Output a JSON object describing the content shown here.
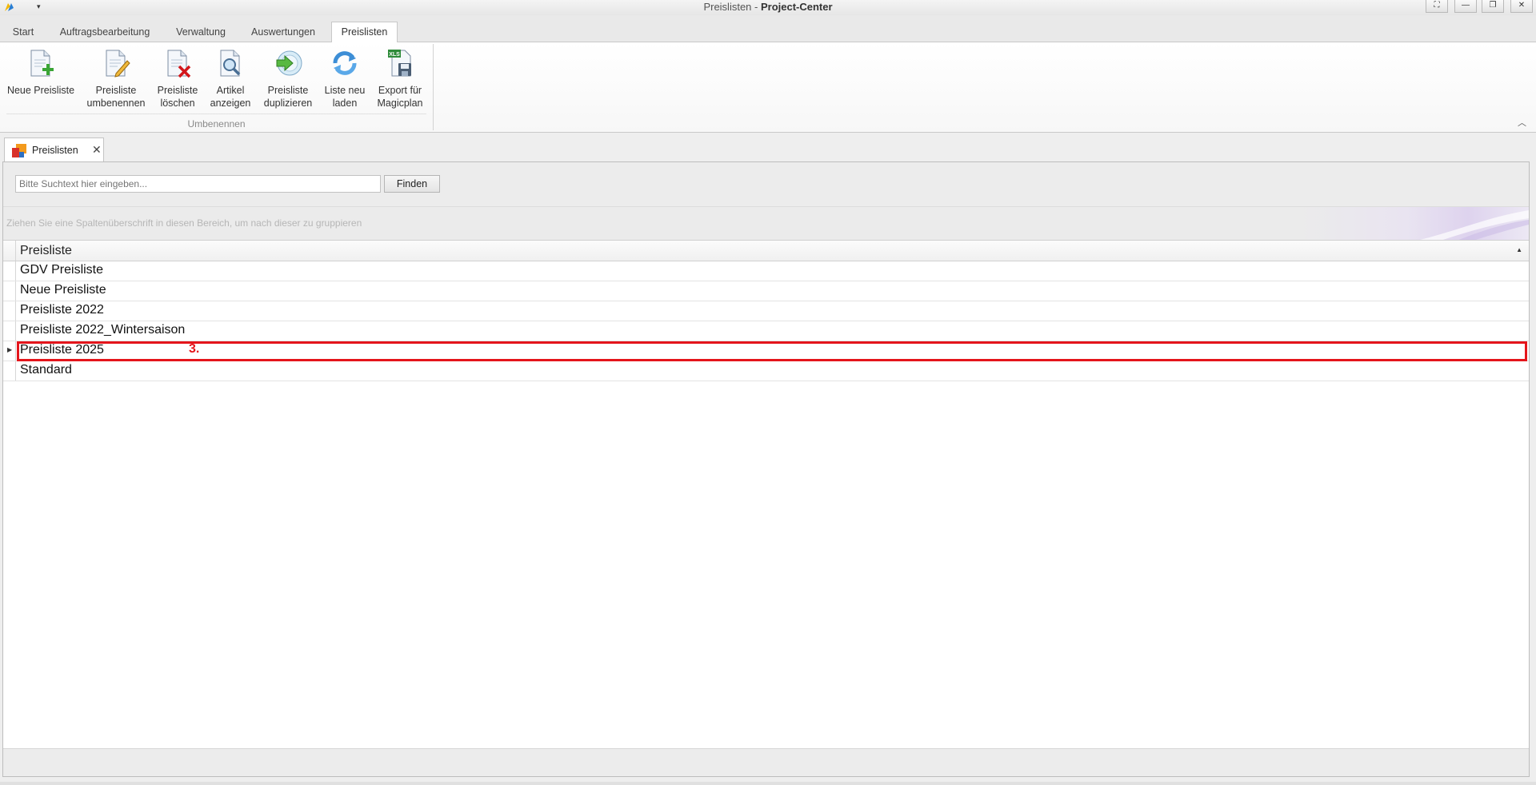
{
  "window": {
    "title_prefix": "Preislisten - ",
    "title_app": "Project-Center",
    "controls": [
      "⛶",
      "—",
      "❐",
      "✕"
    ],
    "quick_access_glyph": "▾"
  },
  "ribbon": {
    "tabs": [
      {
        "label": "Start"
      },
      {
        "label": "Auftragsbearbeitung"
      },
      {
        "label": "Verwaltung"
      },
      {
        "label": "Auswertungen"
      },
      {
        "label": "Preislisten",
        "active": true
      }
    ],
    "buttons": [
      {
        "line1": "Neue Preisliste",
        "line2": "",
        "icon": "new-document-icon"
      },
      {
        "line1": "Preisliste",
        "line2": "umbenennen",
        "icon": "edit-document-icon"
      },
      {
        "line1": "Preisliste",
        "line2": "löschen",
        "icon": "delete-document-icon"
      },
      {
        "line1": "Artikel",
        "line2": "anzeigen",
        "icon": "preview-document-icon"
      },
      {
        "line1": "Preisliste",
        "line2": "duplizieren",
        "icon": "duplicate-icon"
      },
      {
        "line1": "Liste neu",
        "line2": "laden",
        "icon": "refresh-icon"
      },
      {
        "line1": "Export für",
        "line2": "Magicplan",
        "icon": "export-xls-icon"
      }
    ],
    "group_label": "Umbenennen",
    "collapse_glyph": "︿"
  },
  "document_tab": {
    "label": "Preislisten",
    "close_glyph": "✕"
  },
  "search": {
    "placeholder": "Bitte Suchtext hier eingeben...",
    "button_label": "Finden"
  },
  "grid": {
    "group_hint": "Ziehen Sie eine Spaltenüberschrift in diesen Bereich, um nach dieser zu gruppieren",
    "column_header": "Preisliste",
    "sort_glyph": "▲",
    "current_row_glyph": "▶",
    "rows": [
      {
        "name": "GDV Preisliste"
      },
      {
        "name": "Neue Preisliste"
      },
      {
        "name": "Preisliste 2022"
      },
      {
        "name": "Preisliste 2022_Wintersaison"
      },
      {
        "name": "Preisliste 2025",
        "selected": true
      },
      {
        "name": "Standard"
      }
    ],
    "annotation": "3."
  },
  "colors": {
    "highlight": "#e4151b",
    "accent_tab": "#ffffff"
  }
}
